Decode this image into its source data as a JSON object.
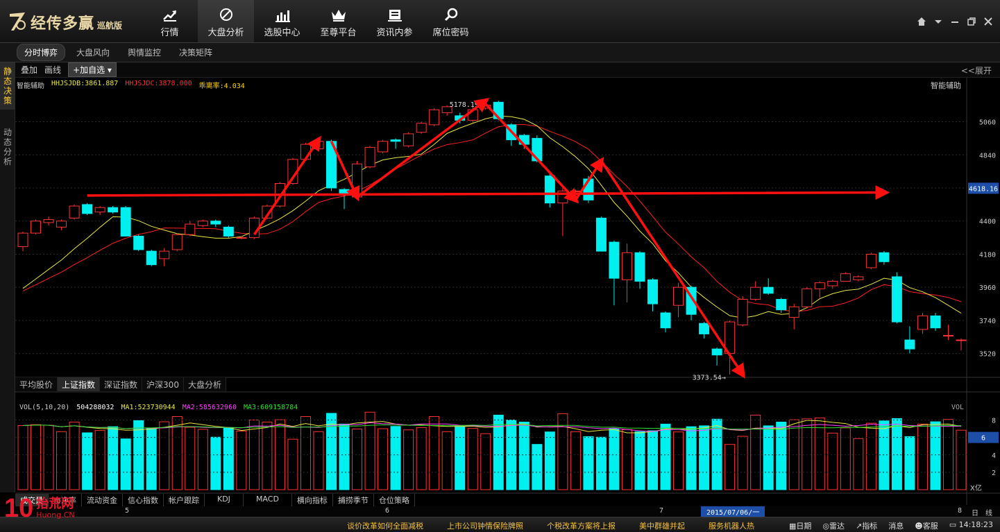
{
  "app": {
    "logo_main": "经传多赢",
    "logo_sub": "巡航版"
  },
  "nav": [
    {
      "label": "行情",
      "icon": "trend-up-icon"
    },
    {
      "label": "大盘分析",
      "icon": "compass-icon"
    },
    {
      "label": "选股中心",
      "icon": "bar-chart-icon"
    },
    {
      "label": "至尊平台",
      "icon": "crown-icon"
    },
    {
      "label": "资讯内参",
      "icon": "news-icon"
    },
    {
      "label": "席位密码",
      "icon": "magnifier-icon"
    }
  ],
  "subtabs": [
    "分时博弈",
    "大盘风向",
    "舆情监控",
    "决策矩阵"
  ],
  "side_tabs": [
    "静态决策",
    "动态分析"
  ],
  "toolbar": {
    "overlay": "叠加",
    "draw": "画线",
    "add": "加自选",
    "expand": "<<展开"
  },
  "indicators": {
    "name": "智能辅助",
    "hhjsjdb": "HHJSJDB:3861.887",
    "hhjsjdc": "HHJSJDC:3878.000",
    "dev": "乖离率:4.034",
    "right_label": "智能辅助"
  },
  "chart_data": {
    "type": "candlestick",
    "y_ticks": [
      "5060",
      "4840",
      "4620",
      "4400",
      "4180",
      "3960",
      "3740",
      "3520"
    ],
    "y_min": 3380,
    "y_max": 5270,
    "current_price": "4618.16",
    "annotations": [
      {
        "text": "5178.19→",
        "value": 5178.19
      },
      {
        "text": "3373.54→",
        "value": 3373.54
      }
    ],
    "candles": [
      [
        4230,
        4320,
        4200,
        4330
      ],
      [
        4320,
        4400,
        4310,
        4410
      ],
      [
        4390,
        4410,
        4370,
        4430
      ],
      [
        4360,
        4400,
        4340,
        4410
      ],
      [
        4420,
        4500,
        4410,
        4510
      ],
      [
        4510,
        4450,
        4440,
        4520
      ],
      [
        4460,
        4490,
        4440,
        4500
      ],
      [
        4490,
        4460,
        4450,
        4500
      ],
      [
        4490,
        4300,
        4300,
        4500
      ],
      [
        4300,
        4210,
        4200,
        4310
      ],
      [
        4200,
        4110,
        4100,
        4210
      ],
      [
        4150,
        4200,
        4100,
        4220
      ],
      [
        4210,
        4310,
        4200,
        4320
      ],
      [
        4310,
        4380,
        4300,
        4400
      ],
      [
        4370,
        4400,
        4360,
        4410
      ],
      [
        4400,
        4380,
        4360,
        4410
      ],
      [
        4360,
        4300,
        4290,
        4370
      ],
      [
        4290,
        4290,
        4280,
        4300
      ],
      [
        4290,
        4420,
        4280,
        4430
      ],
      [
        4420,
        4500,
        4410,
        4510
      ],
      [
        4500,
        4650,
        4490,
        4660
      ],
      [
        4650,
        4810,
        4640,
        4820
      ],
      [
        4810,
        4910,
        4800,
        4920
      ],
      [
        4880,
        4930,
        4870,
        4940
      ],
      [
        4930,
        4620,
        4600,
        4940
      ],
      [
        4610,
        4580,
        4480,
        4620
      ],
      [
        4560,
        4780,
        4550,
        4800
      ],
      [
        4760,
        4890,
        4750,
        4900
      ],
      [
        4860,
        4930,
        4850,
        4940
      ],
      [
        4940,
        4930,
        4880,
        4950
      ],
      [
        4900,
        4980,
        4890,
        4990
      ],
      [
        4990,
        5050,
        4980,
        5060
      ],
      [
        5040,
        5140,
        5030,
        5150
      ],
      [
        5120,
        5160,
        5100,
        5170
      ],
      [
        5100,
        5070,
        5050,
        5120
      ],
      [
        5070,
        5140,
        5050,
        5160
      ],
      [
        5150,
        5170,
        5140,
        5178
      ],
      [
        5190,
        5080,
        5070,
        5200
      ],
      [
        5040,
        4940,
        4900,
        5050
      ],
      [
        4970,
        4910,
        4880,
        4980
      ],
      [
        4950,
        4800,
        4790,
        4970
      ],
      [
        4700,
        4520,
        4490,
        4720
      ],
      [
        4520,
        4600,
        4300,
        4620
      ],
      [
        4600,
        4600,
        4540,
        4610
      ],
      [
        4680,
        4540,
        4520,
        4700
      ],
      [
        4420,
        4200,
        4200,
        4430
      ],
      [
        4260,
        4020,
        3840,
        4270
      ],
      [
        4010,
        4190,
        3860,
        4250
      ],
      [
        4190,
        4000,
        3950,
        4200
      ],
      [
        4010,
        3850,
        3800,
        4020
      ],
      [
        3790,
        3690,
        3660,
        3800
      ],
      [
        3840,
        3960,
        3760,
        3990
      ],
      [
        3960,
        3780,
        3740,
        3970
      ],
      [
        3720,
        3650,
        3620,
        3730
      ],
      [
        3550,
        3510,
        3440,
        3560
      ],
      [
        3520,
        3730,
        3380,
        3740
      ],
      [
        3710,
        3880,
        3700,
        3900
      ],
      [
        3880,
        3960,
        3870,
        4000
      ],
      [
        3960,
        3920,
        3910,
        4020
      ],
      [
        3880,
        3810,
        3790,
        3890
      ],
      [
        3760,
        3830,
        3680,
        3850
      ],
      [
        3830,
        3950,
        3820,
        3960
      ],
      [
        3950,
        3990,
        3890,
        4000
      ],
      [
        3970,
        4000,
        3950,
        4010
      ],
      [
        4000,
        4050,
        4000,
        4060
      ],
      [
        4010,
        4030,
        4000,
        4040
      ],
      [
        4090,
        4180,
        4080,
        4190
      ],
      [
        4190,
        4130,
        4110,
        4200
      ],
      [
        4030,
        3730,
        3720,
        4060
      ],
      [
        3610,
        3550,
        3520,
        3700
      ],
      [
        3680,
        3770,
        3650,
        3790
      ],
      [
        3770,
        3690,
        3670,
        3790
      ],
      [
        3640,
        3640,
        3610,
        3710
      ],
      [
        3610,
        3610,
        3540,
        3620
      ]
    ],
    "vol_label": "VOL(5,10,20)",
    "vol_value": "504288032",
    "ma1": "MA1:523730944",
    "ma2": "MA2:585632960",
    "ma3": "MA3:609158784",
    "vol_ticks": [
      "8",
      "6",
      "4",
      "2"
    ],
    "vol_current": "6",
    "vol_unit": "X亿",
    "vol_right": "VOL"
  },
  "index_tabs": [
    "平均股价",
    "上证指数",
    "深证指数",
    "沪深300",
    "大盘分析"
  ],
  "bottom_tabs": [
    "成交量",
    "市净率",
    "流动资金",
    "信心指数",
    "帐户跟踪",
    "KDJ",
    "MACD",
    "横向指标",
    "捕捞季节",
    "仓位策略"
  ],
  "dates": {
    "d5": "5",
    "d6": "6",
    "d7": "7",
    "d8": "8",
    "current": "2015/07/06/一",
    "period": "日",
    "type": "线"
  },
  "news": [
    "谈价改革如何全面减税",
    "上市公司钟情保险牌照",
    "个税改革方案将上报",
    "美中群雄并起",
    "服务机器人热"
  ],
  "status": {
    "calendar": "日期",
    "radar": "雷达",
    "indicator": "指标",
    "message": "消息",
    "service": "客服",
    "time": "14:18:23"
  },
  "watermark": {
    "num": "10",
    "cn": "抬荒网",
    "en": "Huong.CN"
  },
  "colors": {
    "up": "#ff3333",
    "down": "#00f0f0",
    "ma_short": "#e8e840",
    "ma_long": "#ff2020",
    "arrow": "#ff1010"
  }
}
